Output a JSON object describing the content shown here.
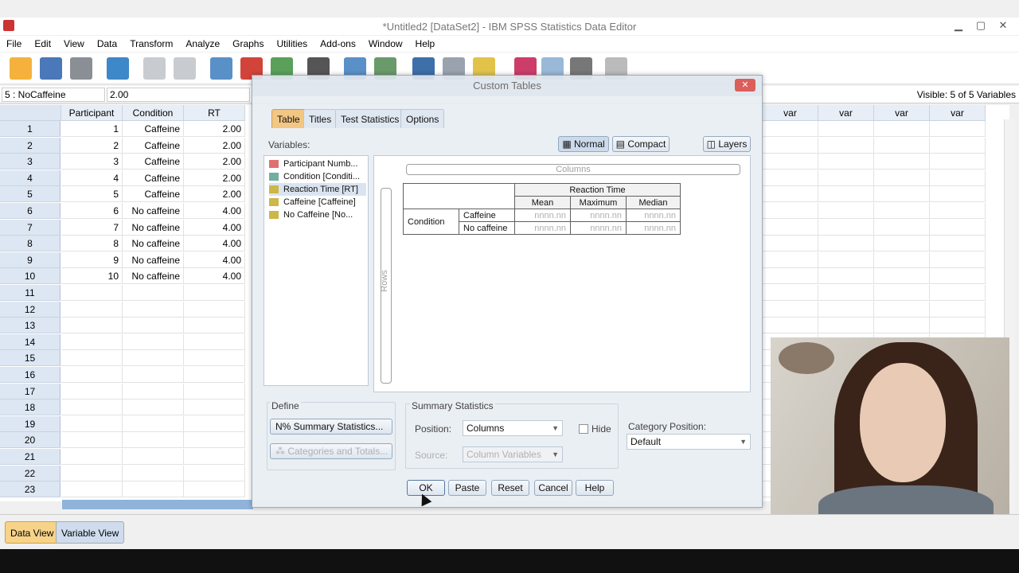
{
  "window": {
    "title": "*Untitled2 [DataSet2] - IBM SPSS Statistics Data Editor"
  },
  "menu": [
    "File",
    "Edit",
    "View",
    "Data",
    "Transform",
    "Analyze",
    "Graphs",
    "Utilities",
    "Add-ons",
    "Window",
    "Help"
  ],
  "cell_info": {
    "name": "5 : NoCaffeine",
    "value": "2.00",
    "visible": "Visible: 5 of 5 Variables"
  },
  "columns": [
    "Participant",
    "Condition",
    "RT"
  ],
  "var_headers": [
    "var",
    "var",
    "var",
    "var",
    "var"
  ],
  "rows": [
    {
      "num": "1",
      "participant": "1",
      "condition": "Caffeine",
      "rt": "2.00"
    },
    {
      "num": "2",
      "participant": "2",
      "condition": "Caffeine",
      "rt": "2.00"
    },
    {
      "num": "3",
      "participant": "3",
      "condition": "Caffeine",
      "rt": "2.00"
    },
    {
      "num": "4",
      "participant": "4",
      "condition": "Caffeine",
      "rt": "2.00"
    },
    {
      "num": "5",
      "participant": "5",
      "condition": "Caffeine",
      "rt": "2.00"
    },
    {
      "num": "6",
      "participant": "6",
      "condition": "No caffeine",
      "rt": "4.00"
    },
    {
      "num": "7",
      "participant": "7",
      "condition": "No caffeine",
      "rt": "4.00"
    },
    {
      "num": "8",
      "participant": "8",
      "condition": "No caffeine",
      "rt": "4.00"
    },
    {
      "num": "9",
      "participant": "9",
      "condition": "No caffeine",
      "rt": "4.00"
    },
    {
      "num": "10",
      "participant": "10",
      "condition": "No caffeine",
      "rt": "4.00"
    }
  ],
  "empty_rows": [
    "11",
    "12",
    "13",
    "14",
    "15",
    "16",
    "17",
    "18",
    "19",
    "20",
    "21",
    "22",
    "23"
  ],
  "bottom_tabs": {
    "data_view": "Data View",
    "variable_view": "Variable View"
  },
  "dialog": {
    "title": "Custom Tables",
    "tabs": [
      "Table",
      "Titles",
      "Test Statistics",
      "Options"
    ],
    "view_buttons": {
      "normal": "Normal",
      "compact": "Compact",
      "layers": "Layers"
    },
    "variables_label": "Variables:",
    "variables": [
      "Participant Numb...",
      "Condition [Conditi...",
      "Reaction Time [RT]",
      "Caffeine [Caffeine]",
      "No Caffeine [No..."
    ],
    "columns_drop": "Columns",
    "rows_drop": "Rows",
    "preview": {
      "header": "Reaction Time",
      "stats": [
        "Mean",
        "Maximum",
        "Median"
      ],
      "row_var": "Condition",
      "categories": [
        "Caffeine",
        "No caffeine"
      ],
      "placeholder": "nnnn.nn"
    },
    "define_label": "Define",
    "summary_btn": "Summary Statistics...",
    "categories_btn": "Categories and Totals...",
    "summary_group": "Summary Statistics",
    "position_label": "Position:",
    "position_value": "Columns",
    "hide_label": "Hide",
    "source_label": "Source:",
    "source_value": "Column Variables",
    "cat_pos_label": "Category Position:",
    "cat_pos_value": "Default",
    "buttons": {
      "ok": "OK",
      "paste": "Paste",
      "reset": "Reset",
      "cancel": "Cancel",
      "help": "Help"
    }
  }
}
